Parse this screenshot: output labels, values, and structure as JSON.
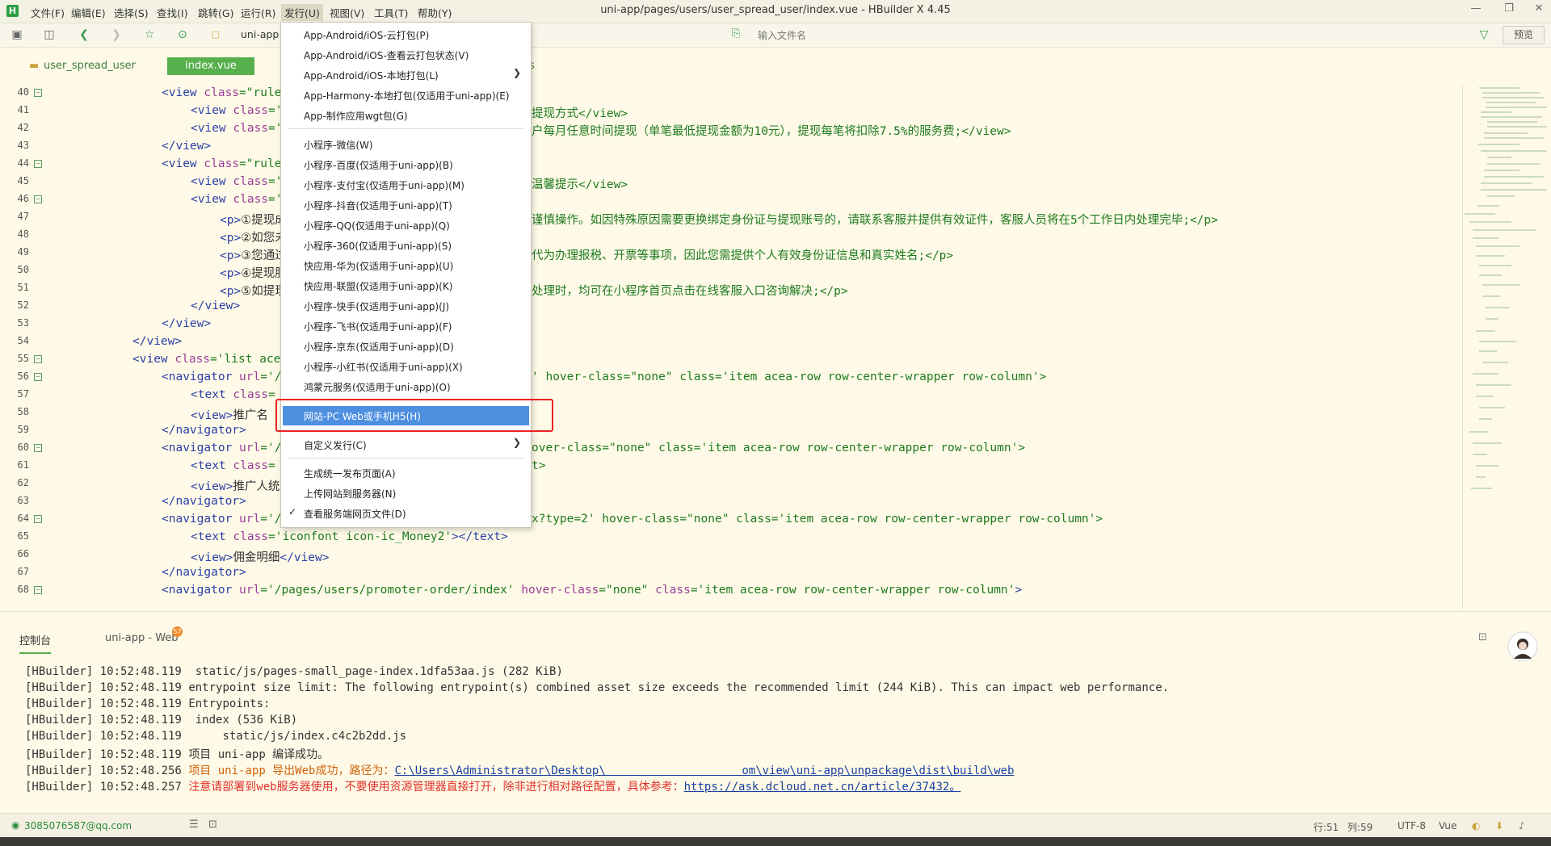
{
  "app": {
    "logo": "H",
    "window_title": "uni-app/pages/users/user_spread_user/index.vue - HBuilder X 4.45",
    "menus": [
      "文件(F)",
      "编辑(E)",
      "选择(S)",
      "查找(I)",
      "跳转(G)",
      "运行(R)",
      "发行(U)",
      "视图(V)",
      "工具(T)",
      "帮助(Y)"
    ],
    "active_menu": "发行(U)",
    "window_buttons": [
      "—",
      "❐",
      "✕"
    ]
  },
  "toolbar": {
    "breadcrumb": "uni-app",
    "search_placeholder": "输入文件名",
    "preview_label": "预览"
  },
  "tabs": {
    "folder": "user_spread_user",
    "active": "index.vue",
    "hidden_tail": "s"
  },
  "editor": {
    "line_numbers": [
      "40",
      "41",
      "42",
      "43",
      "44",
      "45",
      "46",
      "47",
      "48",
      "49",
      "50",
      "51",
      "52",
      "53",
      "54",
      "55",
      "56",
      "57",
      "58",
      "59",
      "60",
      "61",
      "62",
      "63",
      "64",
      "65",
      "66",
      "67",
      "68"
    ],
    "visible_right_fragments": {
      "l41": "提现方式</view>",
      "l42": "户每月任意时间提现（单笔最低提现金额为10元），提现每笔将扣除7.5%的服务费;</view>",
      "l45": "温馨提示</view>",
      "l47": "谨慎操作。如因特殊原因需要更换绑定身份证与提现账号的，请联系客服并提供有效证件，客服人员将在5个工作日内处理完毕;</p>",
      "l49": "代为办理报税、开票等事项，因此您需提供个人有效身份证信息和真实姓名;</p>",
      "l51": "处理时，均可在小程序首页点击在线客服入口咨询解决;</p>",
      "l56": "' hover-class=\"none\" class='item acea-row row-center-wrapper row-column'>",
      "l60": "over-class=\"none\" class='item acea-row row-center-wrapper row-column'>",
      "l61": "t>",
      "l64": "x?type=2' hover-class=\"none\" class='item acea-row row-center-wrapper row-column'>"
    }
  },
  "publish_menu": {
    "group1": [
      "App-Android/iOS-云打包(P)",
      "App-Android/iOS-查看云打包状态(V)",
      "App-Android/iOS-本地打包(L)",
      "App-Harmony-本地打包(仅适用于uni-app)(E)",
      "App-制作应用wgt包(G)"
    ],
    "group2": [
      "小程序-微信(W)",
      "小程序-百度(仅适用于uni-app)(B)",
      "小程序-支付宝(仅适用于uni-app)(M)",
      "小程序-抖音(仅适用于uni-app)(T)",
      "小程序-QQ(仅适用于uni-app)(Q)",
      "小程序-360(仅适用于uni-app)(S)",
      "快应用-华为(仅适用于uni-app)(U)",
      "快应用-联盟(仅适用于uni-app)(K)",
      "小程序-快手(仅适用于uni-app)(J)",
      "小程序-飞书(仅适用于uni-app)(F)",
      "小程序-京东(仅适用于uni-app)(D)",
      "小程序-小红书(仅适用于uni-app)(X)",
      "鸿蒙元服务(仅适用于uni-app)(O)"
    ],
    "highlighted": "网站-PC Web或手机H5(H)",
    "group3": [
      "自定义发行(C)"
    ],
    "group4": [
      "生成统一发布页面(A)",
      "上传网站到服务器(N)",
      "查看服务端网页文件(D)"
    ],
    "checkmark": "✓"
  },
  "console": {
    "tab_console": "控制台",
    "tab_web": "uni-app - Web",
    "web_badge": "57",
    "lines": [
      {
        "prefix": "[HBuilder] 10:52:48.119",
        "text": "  static/js/pages-small_page-index.1dfa53aa.js (282 KiB)"
      },
      {
        "prefix": "[HBuilder] 10:52:48.119",
        "text": "entrypoint size limit: The following entrypoint(s) combined asset size exceeds the recommended limit (244 KiB). This can impact web performance."
      },
      {
        "prefix": "[HBuilder] 10:52:48.119",
        "text": "Entrypoints:"
      },
      {
        "prefix": "[HBuilder] 10:52:48.119",
        "text": "  index (536 KiB)"
      },
      {
        "prefix": "[HBuilder] 10:52:48.119",
        "text": "      static/js/index.c4c2b2dd.js"
      },
      {
        "prefix": "[HBuilder] 10:52:48.119",
        "text": "项目 uni-app 编译成功。"
      }
    ],
    "line7_prefix": "[HBuilder] 10:52:48.256",
    "line7_orange": "项目 uni-app 导出Web成功，路径为：",
    "line7_link": "C:\\Users\\Administrator\\Desktop\\                    om\\view\\uni-app\\unpackage\\dist\\build\\web",
    "line8_prefix": "[HBuilder] 10:52:48.257",
    "line8_red": "注意请部署到web服务器使用，不要使用资源管理器直接打开，除非进行相对路径配置，具体参考：",
    "line8_link": "https://ask.dcloud.net.cn/article/37432。"
  },
  "statusbar": {
    "account": "3085076587@qq.com",
    "line": "行:51",
    "col": "列:59",
    "encoding": "UTF-8",
    "language": "Vue"
  },
  "colors": {
    "accent": "#57b04b",
    "highlight": "#4f8fe0",
    "annotation": "#e22222"
  }
}
